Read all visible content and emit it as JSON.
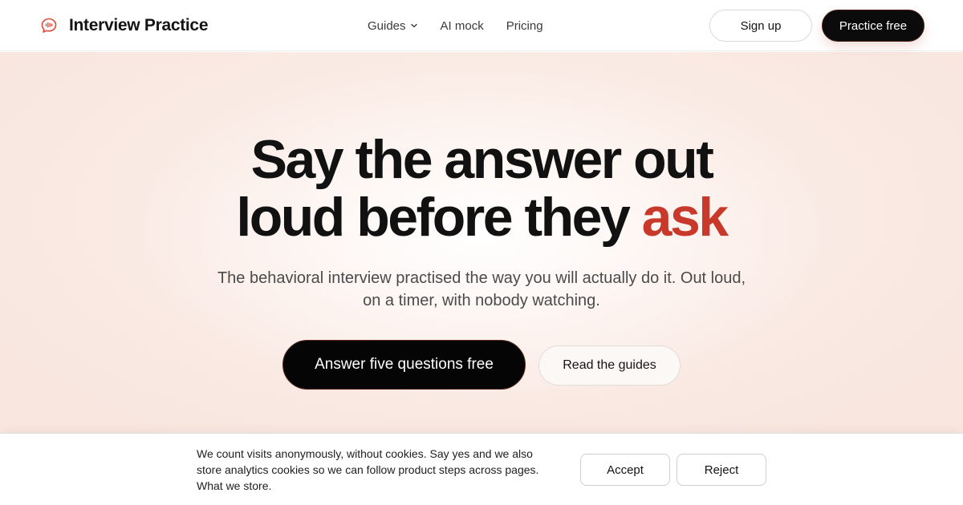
{
  "header": {
    "brand": {
      "name": "Interview Practice",
      "icon": "speech-bubble-waveform-icon"
    },
    "nav": [
      {
        "label": "Guides",
        "has_dropdown": true
      },
      {
        "label": "AI mock"
      },
      {
        "label": "Pricing"
      }
    ],
    "signup_label": "Sign up",
    "practice_label": "Practice free"
  },
  "hero": {
    "headline": {
      "line1": "Say the answer out",
      "line2_prefix": "loud before they ",
      "line2_accent": "ask"
    },
    "subhead": {
      "line1": "The behavioral interview practised the way you will actually do it. Out loud,",
      "line2": "on a timer, with nobody watching."
    },
    "primary_cta": "Answer five questions free",
    "secondary_cta": "Read the guides"
  },
  "cookie_banner": {
    "text_line1": "We count visits anonymously, without cookies. Say yes and we also",
    "text_line2": "store analytics cookies so we can follow product steps across pages.",
    "link": "What we store.",
    "accept_label": "Accept",
    "reject_label": "Reject"
  },
  "colors": {
    "accent": "#c8392b",
    "brand_icon": "#e0493a",
    "primary_button": "#050505",
    "hero_background": "#fdf1ec"
  }
}
